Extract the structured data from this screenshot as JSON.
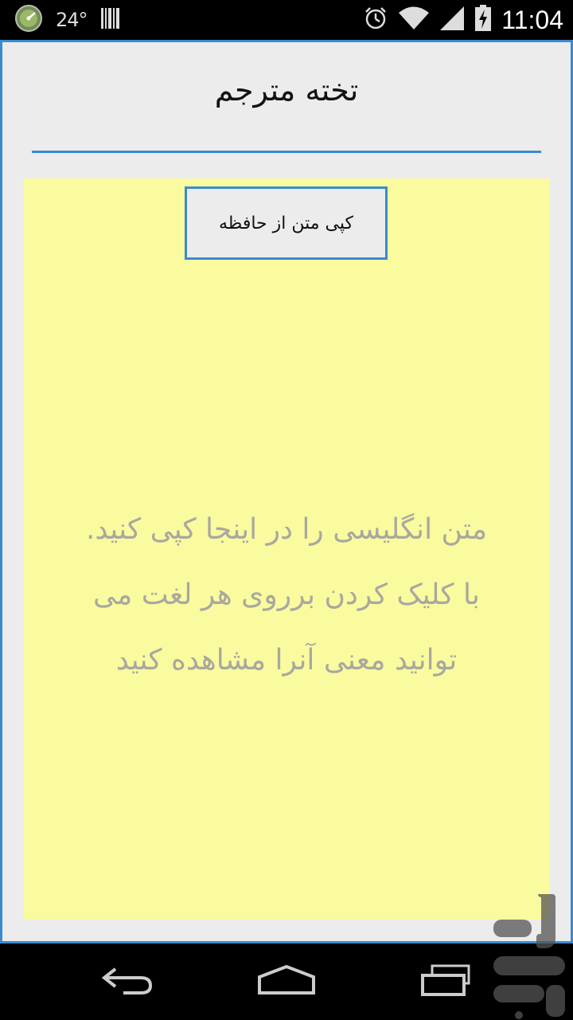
{
  "status_bar": {
    "temperature": "24°",
    "time": "11:04",
    "icons": [
      "speedometer-icon",
      "barcode-icon",
      "alarm-icon",
      "wifi-icon",
      "signal-icon",
      "battery-charging-icon"
    ]
  },
  "app": {
    "title": "تخته مترجم",
    "paste_button_label": "کپی متن از حافظه",
    "hint_lines": [
      "متن انگلیسی را در اینجا کپی کنید.",
      "با کلیک کردن برروی هر لغت می",
      "توانید معنی آنرا مشاهده کنید"
    ]
  },
  "navigation": {
    "icons": [
      "back-icon",
      "home-icon",
      "recent-apps-icon"
    ]
  },
  "colors": {
    "accent": "#3a8ad0",
    "note_background": "#fafa9f",
    "hint_text": "#a8a8a0",
    "app_background": "#ececec"
  }
}
